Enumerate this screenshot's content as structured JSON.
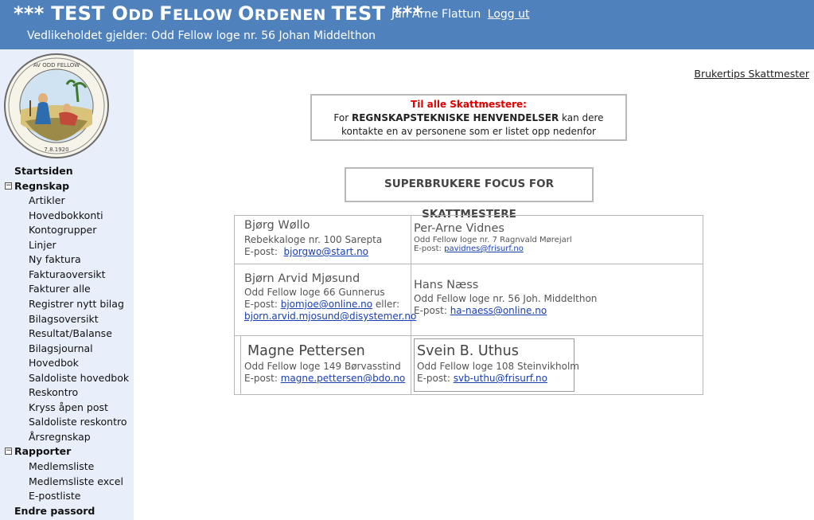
{
  "header": {
    "title_stars_left": "*** ",
    "title_test1": "TEST ",
    "title_o": "O",
    "title_dd": "DD ",
    "title_f": "F",
    "title_ellow": "ELLOW ",
    "title_o2": "O",
    "title_rdenen": "RDENEN ",
    "title_test2": "TEST",
    "title_stars_right": " ***",
    "user_name": "Jan Arne Flattun",
    "logout_label": "Logg ut",
    "subtitle": "Vedlikeholdet gjelder: Odd Fellow loge nr. 56 Johan Middelthon"
  },
  "sidebar": {
    "logo_alt": "Odd Fellow Ordenen seal",
    "items": [
      {
        "label": "Startsiden",
        "level": 0
      },
      {
        "label": "Regnskap",
        "level": 0,
        "toggle": "−"
      },
      {
        "label": "Artikler",
        "level": 1
      },
      {
        "label": "Hovedbokkonti",
        "level": 1
      },
      {
        "label": "Kontogrupper",
        "level": 1
      },
      {
        "label": "Linjer",
        "level": 1
      },
      {
        "label": "Ny faktura",
        "level": 1
      },
      {
        "label": "Fakturaoversikt",
        "level": 1
      },
      {
        "label": "Fakturer alle",
        "level": 1
      },
      {
        "label": "Registrer nytt bilag",
        "level": 1
      },
      {
        "label": "Bilagsoversikt",
        "level": 1
      },
      {
        "label": "Resultat/Balanse",
        "level": 1
      },
      {
        "label": "Bilagsjournal",
        "level": 1
      },
      {
        "label": "Hovedbok",
        "level": 1
      },
      {
        "label": "Saldoliste hovedbok",
        "level": 1
      },
      {
        "label": "Reskontro",
        "level": 1
      },
      {
        "label": "Kryss åpen post",
        "level": 1
      },
      {
        "label": "Saldoliste reskontro",
        "level": 1
      },
      {
        "label": "Årsregnskap",
        "level": 1
      },
      {
        "label": "Rapporter",
        "level": 0,
        "toggle": "−"
      },
      {
        "label": "Medlemsliste",
        "level": 1
      },
      {
        "label": "Medlemsliste excel",
        "level": 1
      },
      {
        "label": "E-postliste",
        "level": 1
      },
      {
        "label": "Endre passord",
        "level": 0
      }
    ]
  },
  "main": {
    "help_link": "Brukertips Skattmester",
    "notice": {
      "title": "Til alle Skattmestere:",
      "text_prefix": "For ",
      "text_bold": "REGNSKAPSTEKNISKE HENVENDELSER",
      "text_suffix": " kan dere kontakte en av personene som er listet opp nedenfor"
    },
    "superuser_title": "SUPERBRUKERE FOCUS FOR SKATTMESTERE",
    "contacts": [
      {
        "name": "Bjørg Wøllo",
        "org": "Rebekkaloge nr. 100 Sarepta",
        "email_label": "E-post:",
        "email": "bjorgwo@start.no"
      },
      {
        "name": "Per-Arne Vidnes",
        "org": "Odd Fellow loge nr. 7 Ragnvald Mørejarl",
        "email_label": "E-post:",
        "email": "pavidnes@frisurf.no"
      },
      {
        "name": "Bjørn Arvid Mjøsund",
        "org": "Odd Fellow loge 66 Gunnerus",
        "email_label": "E-post:",
        "email": "bjomjoe@online.no",
        "email_join": " eller:",
        "email2": "bjorn.arvid.mjosund@disystemer.no"
      },
      {
        "name": "Hans Næss",
        "org": "Odd Fellow loge nr. 56 Joh. Middelthon",
        "email_label": "E-post:",
        "email": "ha-naess@online.no"
      },
      {
        "name": "Magne Pettersen",
        "org": "Odd Fellow loge 149 Børvasstind",
        "email_label": "E-post:",
        "email": "magne.pettersen@bdo.no"
      },
      {
        "name": "Svein B. Uthus",
        "org": "Odd Fellow loge 108 Steinvikholm",
        "email_label": "E-post:",
        "email": "svb-uthu@frisurf.no"
      }
    ]
  }
}
